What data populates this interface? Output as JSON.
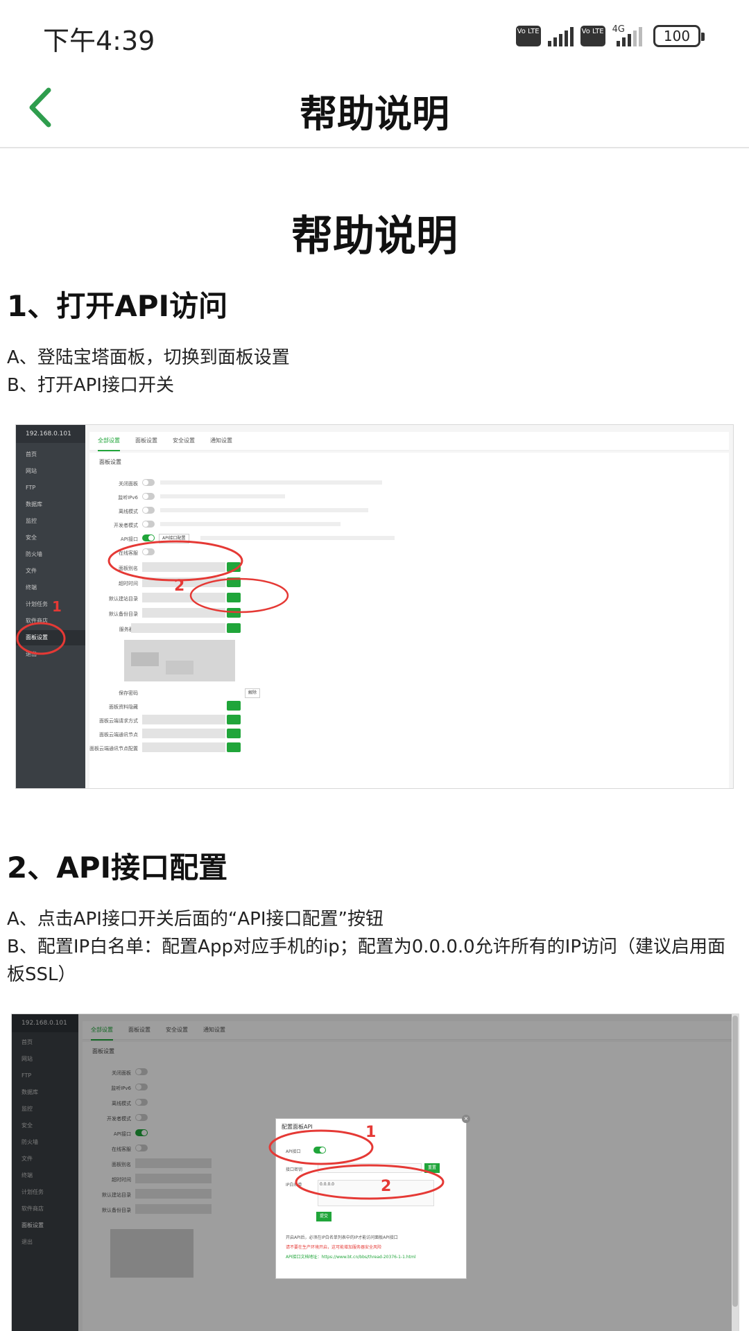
{
  "status_bar": {
    "time": "下午4:39",
    "volte1": "Vo LTE",
    "volte2": "Vo LTE",
    "network_type": "4G",
    "battery": "100"
  },
  "header": {
    "back_icon": "chevron-left-icon",
    "title": "帮助说明",
    "accent_color": "#2e9d4d"
  },
  "doc": {
    "title": "帮助说明",
    "sections": [
      {
        "heading": "1、打开API访问",
        "lines": [
          "A、登陆宝塔面板，切换到面板设置",
          "B、打开API接口开关"
        ]
      },
      {
        "heading": "2、API接口配置",
        "lines": [
          "A、点击API接口开关后面的“API接口配置”按钮",
          "B、配置IP白名单：配置App对应手机的ip；配置为0.0.0.0允许所有的IP访问（建议启用面板SSL）"
        ]
      }
    ]
  },
  "screenshot1": {
    "host": "192.168.0.101",
    "sidebar": [
      "首页",
      "网站",
      "FTP",
      "数据库",
      "监控",
      "安全",
      "防火墙",
      "文件",
      "终端",
      "计划任务",
      "软件商店",
      "面板设置",
      "退出"
    ],
    "tabs": [
      "全部设置",
      "面板设置",
      "安全设置",
      "通知设置"
    ],
    "subtitle": "面板设置",
    "rows": [
      "关闭面板",
      "监听IPv6",
      "离线模式",
      "开发者模式",
      "API接口",
      "在线客服",
      "面板别名",
      "超时时间",
      "默认建站目录",
      "默认备份目录",
      "服务器IP",
      "面板端口",
      "安全入口",
      "授权",
      "面板用户",
      "保存密码",
      "面板资料隐藏",
      "面板云端请求方式",
      "面板云端通讯节点",
      "面板云端通讯节点配置"
    ],
    "api_config_btn": "API接口配置",
    "annotation_1": "1",
    "annotation_2": "2"
  },
  "screenshot2": {
    "host": "192.168.0.101",
    "sidebar": [
      "首页",
      "网站",
      "FTP",
      "数据库",
      "监控",
      "安全",
      "防火墙",
      "文件",
      "终端",
      "计划任务",
      "软件商店",
      "面板设置",
      "退出"
    ],
    "tabs": [
      "全部设置",
      "面板设置",
      "安全设置",
      "通知设置"
    ],
    "subtitle": "面板设置",
    "rows": [
      "关闭面板",
      "监听IPv6",
      "离线模式",
      "开发者模式",
      "API接口",
      "在线客服",
      "面板别名",
      "超时时间",
      "默认建站目录",
      "默认备份目录"
    ],
    "modal_title": "配置面板API",
    "modal_api_label": "API接口",
    "modal_key_label": "接口密钥",
    "modal_reset": "重置",
    "modal_ip_label": "IP白名单",
    "modal_ip_value": "0.0.0.0",
    "modal_submit": "提交",
    "modal_notes": [
      "开启API后，必须在IP白名单列表中的IP才能访问面板API接口",
      "请不要在生产环境开启，这可能增加服务器安全风险",
      "API接口文档地址：https://www.bt.cn/bbs/thread-20376-1-1.html"
    ],
    "annotation_1": "1",
    "annotation_2": "2"
  }
}
